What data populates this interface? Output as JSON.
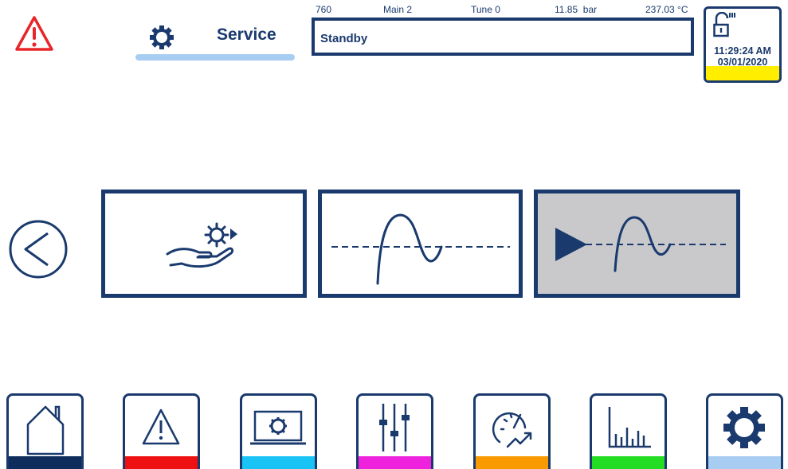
{
  "header": {
    "tab_label": "Service",
    "status_values": [
      "760",
      "Main 2",
      "Tune 0",
      "11.85  bar",
      "237.03 °C"
    ],
    "status_text": "Standby",
    "time": "11:29:24 AM",
    "date": "03/01/2020"
  },
  "icons": {
    "alarm": "warning-triangle-icon",
    "tab": "gear-icon",
    "lock": "unlocked-padlock-icon",
    "back": "chevron-left-circle-icon",
    "tiles": [
      "hand-gear-icon",
      "tuning-curve-icon",
      "play-tuning-curve-icon"
    ],
    "nav": [
      "home-icon",
      "alarm-icon",
      "laptop-gear-icon",
      "sliders-icon",
      "gauge-trend-icon",
      "bar-chart-icon",
      "gear-icon"
    ]
  },
  "colors": {
    "primary": "#1a3a6e",
    "alarm_red": "#e8262a",
    "clock_strip": "#ffee00",
    "selected_tile": "#c9c9cb",
    "tab_underline": "#a8cdf2",
    "nav_bars": [
      "#0e2d5c",
      "#ee1111",
      "#19c3f5",
      "#ee22dd",
      "#f99a00",
      "#22dd22",
      "#a8cdf2"
    ]
  }
}
